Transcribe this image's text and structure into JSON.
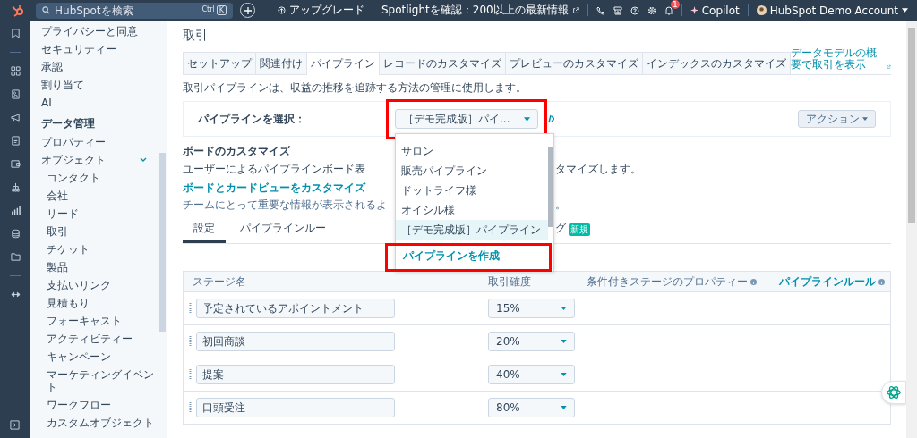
{
  "top_bar": {
    "search": {
      "placeholder": "HubSpotを検索",
      "shortcut": [
        "Ctrl",
        "K"
      ]
    },
    "upgrade": "アップグレード",
    "spotlight": "Spotlightを確認：200以上の最新情報",
    "notifications": "1",
    "copilot": "Copilot",
    "account": "HubSpot Demo Account"
  },
  "sidebar": {
    "items": [
      {
        "kind": "item",
        "label": "プライバシーと同意"
      },
      {
        "kind": "item",
        "label": "セキュリティー"
      },
      {
        "kind": "item",
        "label": "承認"
      },
      {
        "kind": "item",
        "label": "割り当て"
      },
      {
        "kind": "item",
        "label": "AI"
      },
      {
        "kind": "section",
        "label": "データ管理"
      },
      {
        "kind": "item",
        "label": "プロパティー"
      },
      {
        "kind": "item",
        "label": "オブジェクト",
        "expanded": true,
        "children": [
          {
            "kind": "item",
            "label": "コンタクト"
          },
          {
            "kind": "item",
            "label": "会社"
          },
          {
            "kind": "item",
            "label": "リード"
          },
          {
            "kind": "item",
            "label": "取引"
          },
          {
            "kind": "item",
            "label": "チケット"
          },
          {
            "kind": "item",
            "label": "製品"
          },
          {
            "kind": "item",
            "label": "支払いリンク"
          },
          {
            "kind": "item",
            "label": "見積もり"
          },
          {
            "kind": "item",
            "label": "フォーキャスト"
          },
          {
            "kind": "item",
            "label": "アクティビティー"
          },
          {
            "kind": "item",
            "label": "キャンペーン"
          },
          {
            "kind": "item",
            "label": "マーケティングイベント"
          },
          {
            "kind": "item",
            "label": "ワークフロー"
          },
          {
            "kind": "item",
            "label": "カスタムオブジェクト"
          }
        ]
      }
    ]
  },
  "page": {
    "title": "取引",
    "tabs": [
      {
        "label": "セットアップ",
        "selected": false
      },
      {
        "label": "関連付け",
        "selected": false
      },
      {
        "label": "パイプライン",
        "selected": true
      },
      {
        "label": "レコードのカスタマイズ",
        "selected": false
      },
      {
        "label": "プレビューのカスタマイズ",
        "selected": false
      },
      {
        "label": "インデックスのカスタマイズ",
        "selected": false
      }
    ],
    "data_model_link": "データモデルの概要で取引を表示",
    "description": "取引パイプラインは、収益の推移を追跡する方法の管理に使用します。",
    "pipeline_select": {
      "label": "パイプラインを選択：",
      "value": "［デモ完成版］パイ...",
      "actions": "アクション",
      "dropdown": {
        "options": [
          {
            "label": "サロン",
            "selected": false
          },
          {
            "label": "販売パイプライン",
            "selected": false
          },
          {
            "label": "ドットライフ様",
            "selected": false
          },
          {
            "label": "オイシル様",
            "selected": false
          },
          {
            "label": "［デモ完成版］パイプライン",
            "selected": true
          }
        ],
        "create": "パイプラインを作成"
      }
    },
    "board": {
      "heading": "ボードのカスタマイズ",
      "description": [
        "ユーザーによるパイプラインボード表",
        "タマイズします。"
      ],
      "link": "ボードとカードビューをカスタマイズ",
      "hint": [
        "チームにとって重要な情報が表示されるよ",
        "。"
      ]
    },
    "sub_tabs": [
      {
        "label": "設定",
        "selected": true
      },
      {
        "label": "パイプラインルー",
        "selected": false
      },
      {
        "label": "グ",
        "badge": "新規",
        "selected": false
      }
    ],
    "table": {
      "columns": [
        "ステージ名",
        "取引確度",
        "条件付きステージのプロパティー",
        "パイプラインルール"
      ],
      "rows": [
        {
          "stage": "予定されているアポイントメント",
          "probability": "15%"
        },
        {
          "stage": "初回商談",
          "probability": "20%"
        },
        {
          "stage": "提案",
          "probability": "40%"
        },
        {
          "stage": "口頭受注",
          "probability": "80%"
        }
      ]
    }
  }
}
